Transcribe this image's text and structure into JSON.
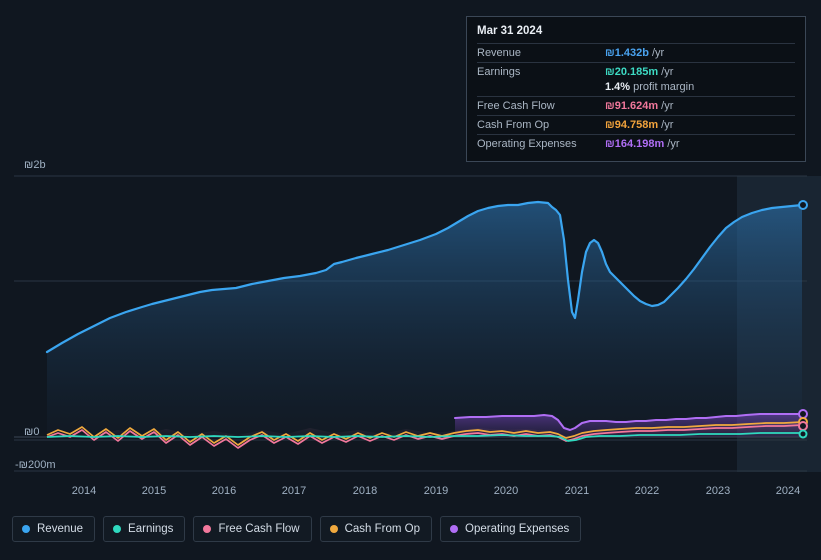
{
  "tooltip": {
    "title": "Mar 31 2024",
    "rows": [
      {
        "label": "Revenue",
        "value": "₪1.432b",
        "unit": "/yr",
        "color": "#4aa3f0"
      },
      {
        "label": "Earnings",
        "value": "₪20.185m",
        "unit": "/yr",
        "color": "#3ddbc4"
      },
      {
        "label": "",
        "value": "1.4%",
        "unit": "profit margin",
        "color": "#e9eef4",
        "sub": true
      },
      {
        "label": "Free Cash Flow",
        "value": "₪91.624m",
        "unit": "/yr",
        "color": "#f2789c"
      },
      {
        "label": "Cash From Op",
        "value": "₪94.758m",
        "unit": "/yr",
        "color": "#f2a33c"
      },
      {
        "label": "Operating Expenses",
        "value": "₪164.198m",
        "unit": "/yr",
        "color": "#b06ef5"
      }
    ]
  },
  "axis": {
    "y_labels": [
      {
        "text": "₪2b",
        "y": 160
      },
      {
        "text": "₪0",
        "y": 427
      },
      {
        "text": "-₪200m",
        "y": 460
      }
    ],
    "x_labels": [
      "2014",
      "2015",
      "2016",
      "2017",
      "2018",
      "2019",
      "2020",
      "2021",
      "2022",
      "2023",
      "2024"
    ]
  },
  "legend": [
    {
      "label": "Revenue",
      "color": "#3aa5f0"
    },
    {
      "label": "Earnings",
      "color": "#2fd9bf"
    },
    {
      "label": "Free Cash Flow",
      "color": "#f2789c"
    },
    {
      "label": "Cash From Op",
      "color": "#f0a93e"
    },
    {
      "label": "Operating Expenses",
      "color": "#b06ef5"
    }
  ],
  "chart_data": {
    "type": "line",
    "title": "",
    "xlabel": "",
    "ylabel": "",
    "ylim": [
      -200000000,
      2000000000
    ],
    "y_ticks": [
      {
        "label": "₪2b",
        "value": 2000000000
      },
      {
        "label": "₪0",
        "value": 0
      },
      {
        "label": "-₪200m",
        "value": -200000000
      }
    ],
    "grid": true,
    "legend_position": "bottom",
    "currency": "₪ (ILS)",
    "x": [
      2013.5,
      2014,
      2014.5,
      2015,
      2015.5,
      2016,
      2016.5,
      2017,
      2017.5,
      2018,
      2018.5,
      2019,
      2019.5,
      2020,
      2020.5,
      2020.9,
      2021.1,
      2021.4,
      2021.7,
      2022,
      2022.4,
      2022.8,
      2023.2,
      2023.6,
      2024.25
    ],
    "series": [
      {
        "name": "Revenue",
        "color": "#3aa5f0",
        "values": [
          0.5,
          0.62,
          0.72,
          0.8,
          0.88,
          0.96,
          1.02,
          1.1,
          1.18,
          1.26,
          1.36,
          1.45,
          1.5,
          1.52,
          1.53,
          1.5,
          0.88,
          1.22,
          1.18,
          0.98,
          0.99,
          1.12,
          1.3,
          1.4,
          1.432
        ],
        "unit": "b ₪"
      },
      {
        "name": "Earnings",
        "color": "#2fd9bf",
        "values": [
          0.008,
          0.01,
          0.012,
          0.01,
          0.014,
          0.012,
          0.016,
          0.014,
          0.018,
          0.016,
          0.02,
          0.018,
          0.022,
          0.02,
          0.024,
          0.018,
          -0.01,
          0.006,
          0.01,
          0.012,
          0.014,
          0.016,
          0.018,
          0.019,
          0.020185
        ],
        "unit": "b ₪"
      },
      {
        "name": "Free Cash Flow",
        "color": "#f2789c",
        "values": [
          0.01,
          0.02,
          0.014,
          0.03,
          0.018,
          0.04,
          0.022,
          0.036,
          0.02,
          0.042,
          0.024,
          0.05,
          0.03,
          0.055,
          0.038,
          0.04,
          0.01,
          0.03,
          0.045,
          0.05,
          0.06,
          0.07,
          0.08,
          0.086,
          0.091624
        ],
        "unit": "b ₪"
      },
      {
        "name": "Cash From Op",
        "color": "#f0a93e",
        "values": [
          0.012,
          0.026,
          0.016,
          0.036,
          0.022,
          0.046,
          0.026,
          0.04,
          0.024,
          0.048,
          0.028,
          0.056,
          0.034,
          0.06,
          0.042,
          0.044,
          0.014,
          0.034,
          0.05,
          0.054,
          0.064,
          0.074,
          0.084,
          0.09,
          0.094758
        ],
        "unit": "b ₪"
      },
      {
        "name": "Operating Expenses",
        "color": "#b06ef5",
        "values": [
          null,
          null,
          null,
          null,
          null,
          null,
          null,
          null,
          null,
          null,
          null,
          0.13,
          0.136,
          0.142,
          0.148,
          0.15,
          0.118,
          0.126,
          0.13,
          0.134,
          0.14,
          0.148,
          0.155,
          0.16,
          0.164198
        ],
        "unit": "b ₪"
      }
    ],
    "annotation": {
      "highlight_date": "Mar 31 2024",
      "highlight_x_fraction": 0.965
    }
  }
}
